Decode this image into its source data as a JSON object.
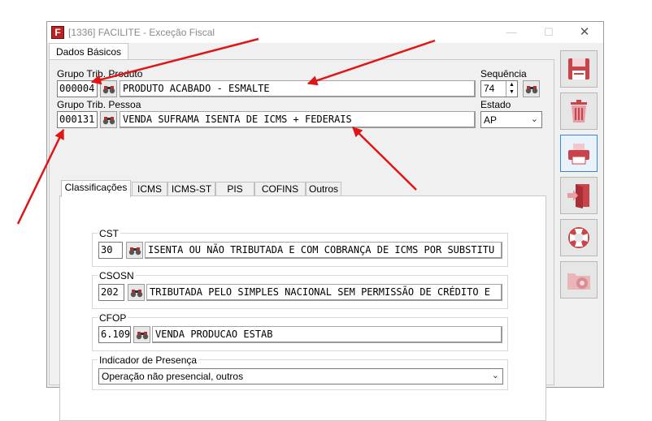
{
  "window": {
    "title": "[1336] FACILITE - Exceção Fiscal",
    "app_icon_letter": "F",
    "minimize": "—",
    "maximize": "☐",
    "close": "✕"
  },
  "main_tab": "Dados Básicos",
  "header": {
    "grupo_produto": {
      "label": "Grupo Trib. Produto",
      "code": "000004",
      "description": "PRODUTO ACABADO - ESMALTE"
    },
    "grupo_pessoa": {
      "label": "Grupo Trib. Pessoa",
      "code": "000131",
      "description": "VENDA SUFRAMA ISENTA DE ICMS + FEDERAIS"
    },
    "sequencia": {
      "label": "Sequência",
      "value": "74"
    },
    "estado": {
      "label": "Estado",
      "value": "AP"
    }
  },
  "sub_tabs": [
    "Classificações",
    "ICMS",
    "ICMS-ST",
    "PIS",
    "COFINS",
    "Outros"
  ],
  "classificacoes": {
    "cst": {
      "label": "CST",
      "code": "30",
      "description": "ISENTA OU NÃO TRIBUTADA E COM COBRANÇA DE ICMS POR SUBSTITU"
    },
    "csosn": {
      "label": "CSOSN",
      "code": "202",
      "description": "TRIBUTADA PELO SIMPLES NACIONAL SEM PERMISSÃO DE CRÉDITO E"
    },
    "cfop": {
      "label": "CFOP",
      "code": "6.109",
      "description": "VENDA PRODUCAO ESTAB"
    },
    "indicador_presenca": {
      "label": "Indicador de Presença",
      "value": "Operação não presencial, outros"
    }
  },
  "sidebar": [
    "save-icon",
    "trash-icon",
    "printer-icon",
    "exit-door-icon",
    "lifebuoy-icon",
    "settings-icon"
  ],
  "colors": {
    "accent_red": "#e01515",
    "icon_red": "#c9434a",
    "focus_blue": "#3a85d3"
  }
}
